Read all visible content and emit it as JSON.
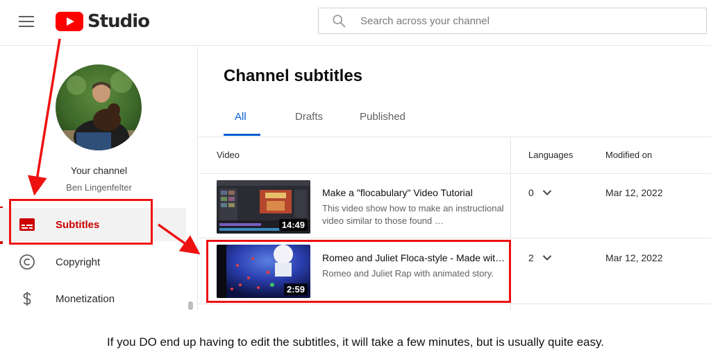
{
  "header": {
    "logo_text": "Studio",
    "search_placeholder": "Search across your channel"
  },
  "sidebar": {
    "your_channel": "Your channel",
    "channel_name": "Ben Lingenfelter",
    "items": [
      {
        "label": "Subtitles",
        "icon": "subtitles-icon",
        "active": true
      },
      {
        "label": "Copyright",
        "icon": "copyright-icon",
        "active": false
      },
      {
        "label": "Monetization",
        "icon": "dollar-icon",
        "active": false
      }
    ]
  },
  "main": {
    "title": "Channel subtitles",
    "tabs": [
      {
        "label": "All",
        "active": true
      },
      {
        "label": "Drafts",
        "active": false
      },
      {
        "label": "Published",
        "active": false
      }
    ],
    "columns": {
      "video": "Video",
      "languages": "Languages",
      "modified": "Modified on"
    },
    "rows": [
      {
        "title": "Make a \"flocabulary\" Video Tutorial",
        "description": "This video show how to make an instructional video similar to those found …",
        "duration": "14:49",
        "languages": "0",
        "modified": "Mar 12, 2022"
      },
      {
        "title": "Romeo and Juliet Floca-style - Made wit…",
        "description": "Romeo and Juliet Rap with animated story.",
        "duration": "2:59",
        "languages": "2",
        "modified": "Mar 12, 2022"
      }
    ]
  },
  "caption": "If you DO end up having to edit the subtitles, it will take a few minutes, but is usually quite easy.",
  "colors": {
    "youtube_red": "#ff0000",
    "annotation_red": "#ee1111",
    "accent_blue": "#065fd4",
    "active_red": "#cc0000"
  }
}
